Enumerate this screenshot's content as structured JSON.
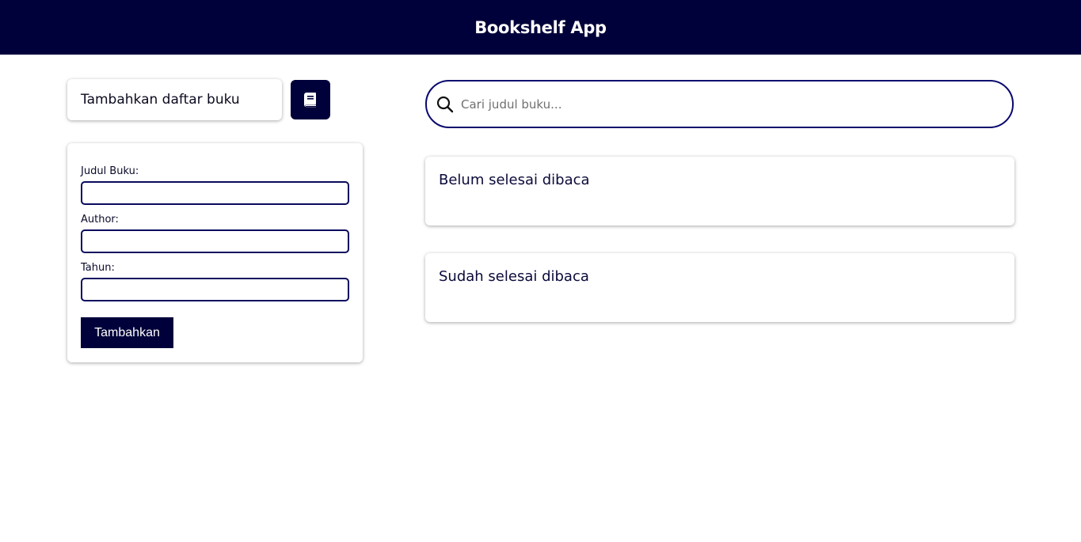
{
  "header": {
    "title": "Bookshelf App"
  },
  "add_toggle": {
    "label": "Tambahkan daftar buku",
    "icon": "book-icon"
  },
  "form": {
    "fields": [
      {
        "label": "Judul Buku:",
        "value": ""
      },
      {
        "label": "Author:",
        "value": ""
      },
      {
        "label": "Tahun:",
        "value": ""
      }
    ],
    "submit_label": "Tambahkan"
  },
  "search": {
    "placeholder": "Cari judul buku...",
    "value": "",
    "icon": "search-icon"
  },
  "shelves": [
    {
      "title": "Belum selesai dibaca"
    },
    {
      "title": "Sudah selesai dibaca"
    }
  ],
  "colors": {
    "primary": "#00003a",
    "border": "#0a0a6e",
    "background": "#ffffff"
  }
}
